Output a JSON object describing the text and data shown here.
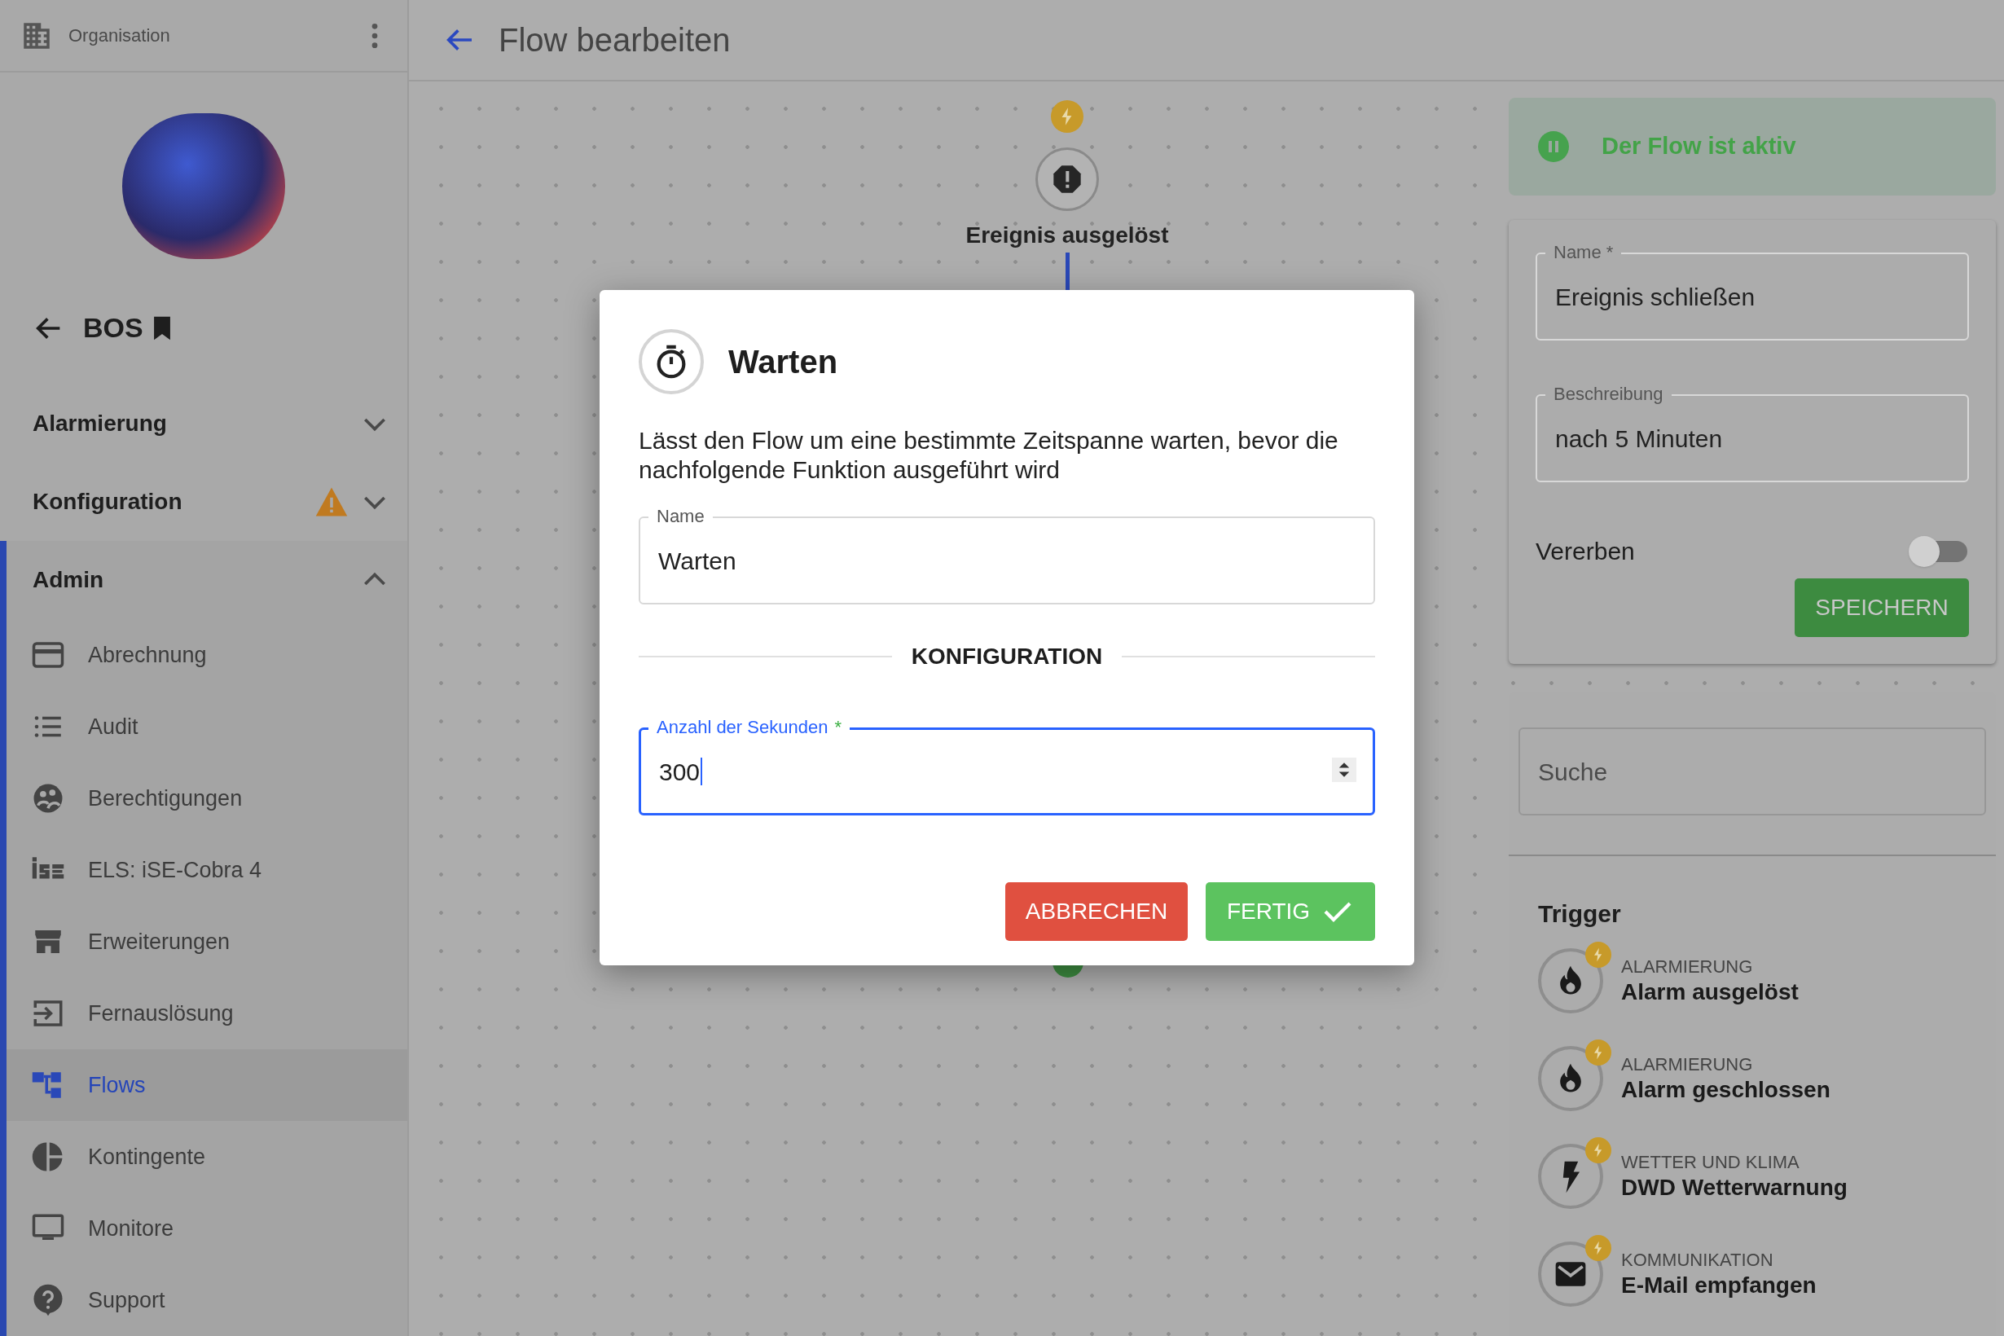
{
  "sidebar": {
    "header": {
      "title": "Organisation"
    },
    "org": {
      "name": "BOS"
    },
    "sections": [
      {
        "label": "Alarmierung",
        "expanded": false,
        "warning": false
      },
      {
        "label": "Konfiguration",
        "expanded": false,
        "warning": true
      },
      {
        "label": "Admin",
        "expanded": true,
        "warning": false,
        "items": [
          {
            "label": "Abrechnung",
            "selected": false
          },
          {
            "label": "Audit",
            "selected": false
          },
          {
            "label": "Berechtigungen",
            "selected": false
          },
          {
            "label": "ELS: iSE-Cobra 4",
            "selected": false
          },
          {
            "label": "Erweiterungen",
            "selected": false
          },
          {
            "label": "Fernauslösung",
            "selected": false
          },
          {
            "label": "Flows",
            "selected": true
          },
          {
            "label": "Kontingente",
            "selected": false
          },
          {
            "label": "Monitore",
            "selected": false
          },
          {
            "label": "Support",
            "selected": false
          }
        ]
      }
    ]
  },
  "page": {
    "title": "Flow bearbeiten"
  },
  "canvas": {
    "nodes": [
      {
        "label": "Ereignis ausgelöst"
      }
    ]
  },
  "dialog": {
    "title": "Warten",
    "description": "Lässt den Flow um eine bestimmte Zeitspanne warten, bevor die nachfolgende Funktion ausgeführt wird",
    "name_field": {
      "label": "Name",
      "value": "Warten"
    },
    "section_title": "KONFIGURATION",
    "seconds_field": {
      "label": "Anzahl der Sekunden",
      "required_mark": "*",
      "value": "300",
      "focused": true
    },
    "buttons": [
      {
        "label": "ABBRECHEN",
        "kind": "cancel"
      },
      {
        "label": "FERTIG",
        "kind": "confirm"
      }
    ]
  },
  "panel": {
    "status": {
      "text": "Der Flow ist aktiv",
      "active": true
    },
    "name_field": {
      "label": "Name *",
      "value": "Ereignis schließen"
    },
    "description_field": {
      "label": "Beschreibung",
      "value": "nach 5 Minuten"
    },
    "inherit": {
      "label": "Vererben",
      "on": false
    },
    "save_button": "SPEICHERN",
    "search": {
      "placeholder": "Suche"
    },
    "triggers_title": "Trigger",
    "triggers": [
      {
        "category": "ALARMIERUNG",
        "name": "Alarm ausgelöst"
      },
      {
        "category": "ALARMIERUNG",
        "name": "Alarm geschlossen"
      },
      {
        "category": "WETTER UND KLIMA",
        "name": "DWD Wetterwarnung"
      },
      {
        "category": "KOMMUNIKATION",
        "name": "E-Mail empfangen"
      }
    ]
  }
}
